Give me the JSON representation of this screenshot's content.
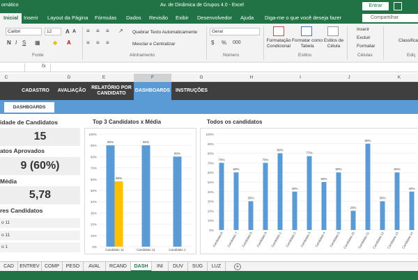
{
  "titlebar": {
    "left_text": "omático",
    "doc_title": "Av. de Dinâmica de Grupos 4.0  -  Excel",
    "login": "Entrar"
  },
  "ribbon_tabs": [
    "Inicial",
    "Inserir",
    "Layout da Página",
    "Fórmulas",
    "Dados",
    "Revisão",
    "Exibir",
    "Desenvolvedor",
    "Ajuda"
  ],
  "tell_me": "Diga-me o que você deseja fazer",
  "share": "Compartilhar",
  "ribbon": {
    "font_name": "Calibri",
    "font_size": "12",
    "wrap_text": "Quebrar Texto Automaticamente",
    "merge_center": "Mesclar e Centralizar",
    "number_format": "Geral",
    "conditional_format": "Formatação Condicional",
    "format_table": "Formatar como Tabela",
    "cell_styles": "Estilos de Célula",
    "insert": "Inserir",
    "delete": "Excluir",
    "format": "Formatar",
    "sort_filter": "Classificar e Filtrar",
    "groups": {
      "font": "Fonte",
      "alignment": "Alinhamento",
      "number": "Número",
      "styles": "Estilos",
      "cells": "Células",
      "editing": "Ediç"
    }
  },
  "formula_bar": {
    "fx": "fx"
  },
  "columns": [
    "C",
    "D",
    "E",
    "F",
    "G",
    "H",
    "I",
    "J",
    "K"
  ],
  "nav": {
    "items": [
      "CADASTRO",
      "AVALIAÇÃO",
      "RELATÓRIO POR CANDIDATO",
      "DASHBOARDS",
      "INSTRUÇÕES"
    ],
    "active": "DASHBOARDS"
  },
  "subtab": "DASHBOARDS",
  "kpis": {
    "total_title": "idade de Candidatos",
    "total_value": "15",
    "approved_title": "atos Aprovados",
    "approved_value": "9 (60%)",
    "avg_title": "Média",
    "avg_value": "5,78",
    "top_title": "res Candidatos",
    "top_items": [
      "o 11",
      "o 11",
      "o 1"
    ]
  },
  "top3": {
    "title": "Top 3 Candidatos x Média"
  },
  "all": {
    "title": "Todos os candidatos"
  },
  "chart_data": [
    {
      "type": "bar",
      "title": "Top 3 Candidatos x Média",
      "categories": [
        "Candidato 11",
        "Candidato 11",
        "Candidato 1"
      ],
      "series": [
        {
          "values": [
            90,
            90,
            80
          ],
          "color": "#5b9bd5"
        },
        {
          "values": [
            58,
            null,
            null
          ],
          "color": "#ffc000"
        }
      ],
      "data_labels": [
        "90%",
        "58%",
        "90%",
        "80%"
      ],
      "yticks": [
        "0%",
        "10%",
        "20%",
        "30%",
        "40%",
        "50%",
        "60%",
        "70%",
        "80%",
        "90%",
        "100%"
      ],
      "ylim": [
        0,
        100
      ]
    },
    {
      "type": "bar",
      "title": "Todos os candidatos",
      "categories": [
        "Candidato 6",
        "Candidato 7",
        "Candidato 8",
        "Candidato 9",
        "Candidato 1",
        "Candidato 2",
        "Candidato 3",
        "Candidato 4",
        "Candidato 5",
        "Candidato 10",
        "Candidato 11",
        "Candidato 12",
        "Candidato 13",
        "Candidato 14"
      ],
      "values": [
        70,
        60,
        30,
        70,
        80,
        40,
        77,
        50,
        60,
        20,
        90,
        30,
        60,
        40
      ],
      "labels": [
        "70%",
        "60%",
        "30%",
        "70%",
        "80%",
        "40%",
        "77%",
        "50%",
        "60%",
        "20%",
        "90%",
        "30%",
        "60%",
        "40%"
      ],
      "yticks": [
        "0%",
        "10%",
        "20%",
        "30%",
        "40%",
        "50%",
        "60%",
        "70%",
        "80%",
        "90%",
        "100%"
      ],
      "ylim": [
        0,
        100
      ],
      "color": "#5b9bd5"
    }
  ],
  "sheet_tabs": [
    "CAD",
    "ENTREV",
    "COMP",
    "PESO",
    "AVAL",
    "RCAND",
    "DASH",
    "INI",
    "DUV",
    "SUG",
    "LUZ"
  ],
  "active_sheet": "DASH",
  "icons": {
    "plus": "+",
    "chevron": "▾",
    "formula": "fx"
  }
}
